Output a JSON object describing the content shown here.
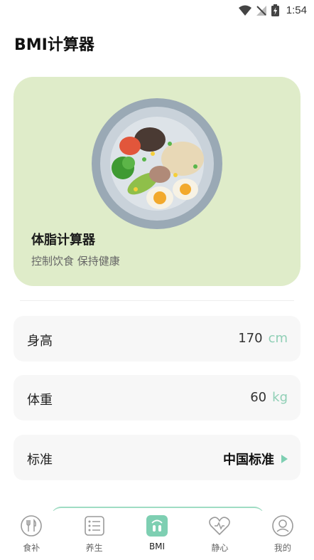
{
  "status": {
    "time": "1:54"
  },
  "page": {
    "title": "BMI计算器"
  },
  "hero": {
    "title": "体脂计算器",
    "subtitle": "控制饮食 保持健康"
  },
  "fields": [
    {
      "label": "身高",
      "value": "170",
      "unit": "cm"
    },
    {
      "label": "体重",
      "value": "60",
      "unit": "kg"
    },
    {
      "label": "标准",
      "value": "中国标准"
    }
  ],
  "tabs": [
    {
      "label": "食补",
      "icon": "food-icon",
      "active": false
    },
    {
      "label": "养生",
      "icon": "list-icon",
      "active": false
    },
    {
      "label": "BMI",
      "icon": "scale-icon",
      "active": true
    },
    {
      "label": "静心",
      "icon": "heart-icon",
      "active": false
    },
    {
      "label": "我的",
      "icon": "profile-icon",
      "active": false
    }
  ],
  "colors": {
    "accent": "#7ecfb2",
    "hero_bg": "#dfecc9",
    "row_bg": "#f7f7f7"
  }
}
